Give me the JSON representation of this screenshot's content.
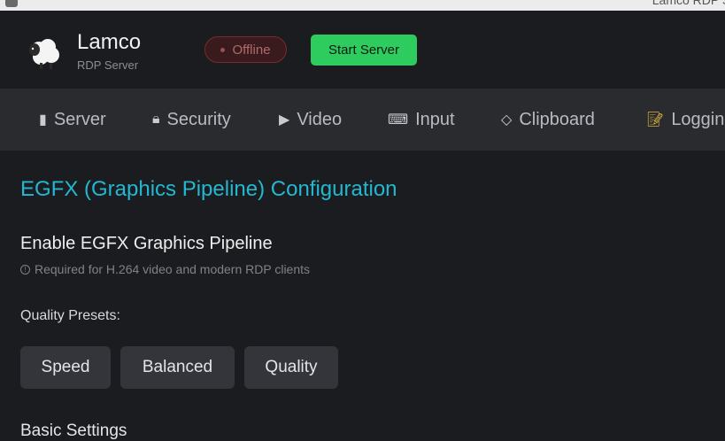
{
  "window": {
    "title": "Lamco RDP Se"
  },
  "header": {
    "app_name": "Lamco",
    "app_subtitle": "RDP Server",
    "logo_icon": "sheep-icon",
    "status": {
      "label": "Offline",
      "color": "#b06a6b"
    },
    "start_button_label": "Start Server",
    "accent_color": "#2ecc5f"
  },
  "tabs": [
    {
      "icon": "server-icon",
      "glyph": "▮",
      "label": "Server"
    },
    {
      "icon": "lock-icon",
      "glyph": "🔒︎",
      "label": "Security"
    },
    {
      "icon": "video-icon",
      "glyph": "▶",
      "label": "Video"
    },
    {
      "icon": "keyboard-icon",
      "glyph": "⌨",
      "label": "Input"
    },
    {
      "icon": "clipboard-icon",
      "glyph": "◇",
      "label": "Clipboard"
    },
    {
      "icon": "memo-icon",
      "glyph": "📝︎",
      "label": "Logging"
    }
  ],
  "main": {
    "section_title": "EGFX (Graphics Pipeline) Configuration",
    "section_title_color": "#22b8d1",
    "enable_label": "Enable EGFX Graphics Pipeline",
    "enable_hint": "Required for H.264 video and modern RDP clients",
    "hint_icon": "info-icon",
    "presets_label": "Quality Presets:",
    "presets": [
      {
        "label": "Speed"
      },
      {
        "label": "Balanced"
      },
      {
        "label": "Quality"
      }
    ],
    "basic_settings_label": "Basic Settings"
  }
}
